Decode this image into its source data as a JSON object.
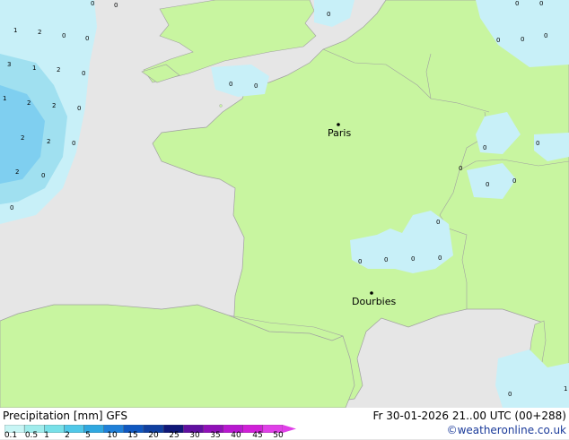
{
  "map": {
    "cities": [
      {
        "name": "Paris"
      },
      {
        "name": "Dourbies"
      }
    ],
    "value_labels": [
      "1",
      "2",
      "0",
      "0",
      "0",
      "0",
      "3",
      "1",
      "2",
      "0",
      "1",
      "2",
      "2",
      "0",
      "2",
      "2",
      "0",
      "2",
      "0",
      "0",
      "0",
      "0",
      "0",
      "0",
      "0",
      "0",
      "0",
      "0",
      "0",
      "0",
      "0",
      "0",
      "0",
      "0",
      "0",
      "0",
      "0",
      "0",
      "1",
      "0"
    ]
  },
  "footer": {
    "title": "Precipitation [mm]  GFS",
    "datetime": "Fr 30-01-2026 21..00 UTC (00+288)",
    "credit": "©weatheronline.co.uk",
    "legend": {
      "ticks": [
        "0.1",
        "0.5",
        "1",
        "2",
        "5",
        "10",
        "15",
        "20",
        "25",
        "30",
        "35",
        "40",
        "45",
        "50"
      ],
      "colors": [
        "#c8f5f5",
        "#a0ecec",
        "#78e0e8",
        "#50c8e8",
        "#30a8e0",
        "#2080d8",
        "#1058c0",
        "#1040a0",
        "#101878",
        "#6010a0",
        "#9010b8",
        "#b818d0",
        "#d020d8",
        "#e040e8"
      ]
    }
  },
  "colors": {
    "sea": "#e6e6e6",
    "land": "#c8f5a0",
    "border": "#a0a0a0",
    "light_precip": "#c8f0f8",
    "medium_precip": "#a0e0f0",
    "heavy_precip": "#70c8f0"
  }
}
